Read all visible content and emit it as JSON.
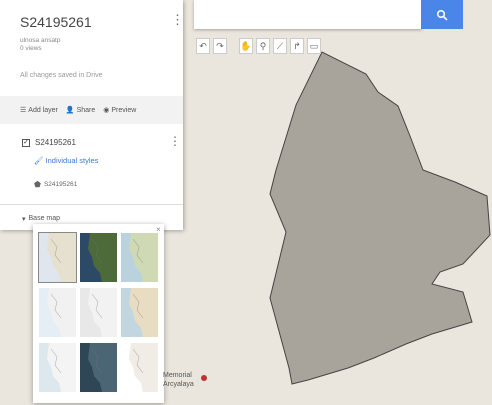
{
  "map": {
    "title": "S24195261",
    "meta_line1": "ulnosa ansatp",
    "meta_line2": "0 views",
    "saved_status": "All changes saved in Drive"
  },
  "actions": {
    "add_layer": "Add layer",
    "share": "Share",
    "preview": "Preview"
  },
  "layer": {
    "name": "S24195261",
    "styles_link": "Individual styles",
    "feature_name": "S24195261"
  },
  "basemap": {
    "label": "Base map",
    "close": "×",
    "thumbnails": [
      {
        "name": "Map",
        "bg": "#dfe6ee",
        "land": "#e6e0cf",
        "selected": true
      },
      {
        "name": "Satellite",
        "bg": "#2c4a66",
        "land": "#4d6a3a",
        "selected": false
      },
      {
        "name": "Terrain",
        "bg": "#b9d2dd",
        "land": "#cfd9b4",
        "selected": false
      },
      {
        "name": "Light political",
        "bg": "#e6eef5",
        "land": "#f1f1f1",
        "selected": false
      },
      {
        "name": "Mono city",
        "bg": "#e8e8e8",
        "land": "#f2f2f2",
        "selected": false
      },
      {
        "name": "Simple atlas",
        "bg": "#c2d6e0",
        "land": "#e8dcc2",
        "selected": false
      },
      {
        "name": "Light landmass",
        "bg": "#dde7ee",
        "land": "#f4f4f4",
        "selected": false
      },
      {
        "name": "Dark landmass",
        "bg": "#2f4657",
        "land": "#4c6575",
        "selected": false
      },
      {
        "name": "Whitewater",
        "bg": "#ffffff",
        "land": "#f1ece6",
        "selected": false
      }
    ]
  },
  "place_label": {
    "line1": "Memorial",
    "line2": "Arcyalaya"
  },
  "colors": {
    "accent": "#4a86e8",
    "polygon_fill": "#a8a49c",
    "polygon_stroke": "#444444",
    "map_background": "#eae6dd"
  },
  "icons": {
    "search": "search-icon",
    "toolbar": [
      "undo-icon",
      "redo-icon",
      "hand-icon",
      "marker-icon",
      "polygon-icon",
      "route-icon",
      "ruler-icon"
    ]
  }
}
